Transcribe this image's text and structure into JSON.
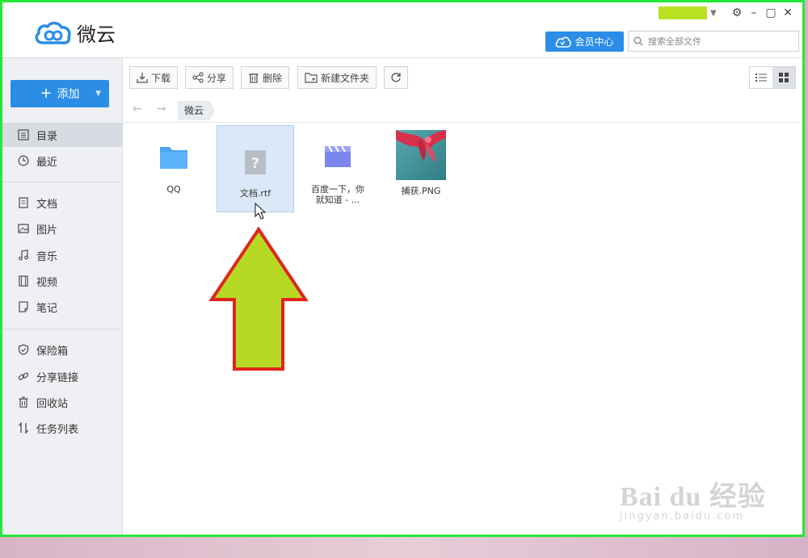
{
  "app": {
    "title": "微云"
  },
  "topbar": {
    "vip_label": "会员中心",
    "search_placeholder": "搜索全部文件",
    "window_controls": [
      "gear-icon",
      "minimize-icon",
      "maximize-icon",
      "close-icon"
    ],
    "highlight_color": "#b9e021"
  },
  "sidebar": {
    "add_label": "添加",
    "items": [
      {
        "label": "目录",
        "icon": "list-icon"
      },
      {
        "label": "最近",
        "icon": "clock-icon"
      },
      {
        "label": "文档",
        "icon": "document-icon"
      },
      {
        "label": "图片",
        "icon": "image-icon"
      },
      {
        "label": "音乐",
        "icon": "music-icon"
      },
      {
        "label": "视频",
        "icon": "video-icon"
      },
      {
        "label": "笔记",
        "icon": "note-icon"
      },
      {
        "label": "保险箱",
        "icon": "shield-icon"
      },
      {
        "label": "分享链接",
        "icon": "link-icon"
      },
      {
        "label": "回收站",
        "icon": "trash-icon"
      },
      {
        "label": "任务列表",
        "icon": "transfer-icon"
      }
    ]
  },
  "toolbar": {
    "download": "下载",
    "share": "分享",
    "delete": "删除",
    "new_folder": "新建文件夹"
  },
  "breadcrumb": {
    "current": "微云"
  },
  "files": [
    {
      "name": "QQ",
      "type": "folder"
    },
    {
      "name": "文档.rtf",
      "type": "unknown"
    },
    {
      "name": "百度一下，你就知道 - ...",
      "line1": "百度一下，你",
      "line2": "就知道 - ...",
      "type": "video"
    },
    {
      "name": "捕获.PNG",
      "type": "image"
    }
  ],
  "watermark": {
    "main": "Bai du 经验",
    "sub": "jingyan.baidu.com"
  },
  "colors": {
    "accent": "#2b8de6",
    "frame": "#27e63a",
    "annotation_arrow_fill": "#b5d924",
    "annotation_arrow_stroke": "#e0261c"
  }
}
